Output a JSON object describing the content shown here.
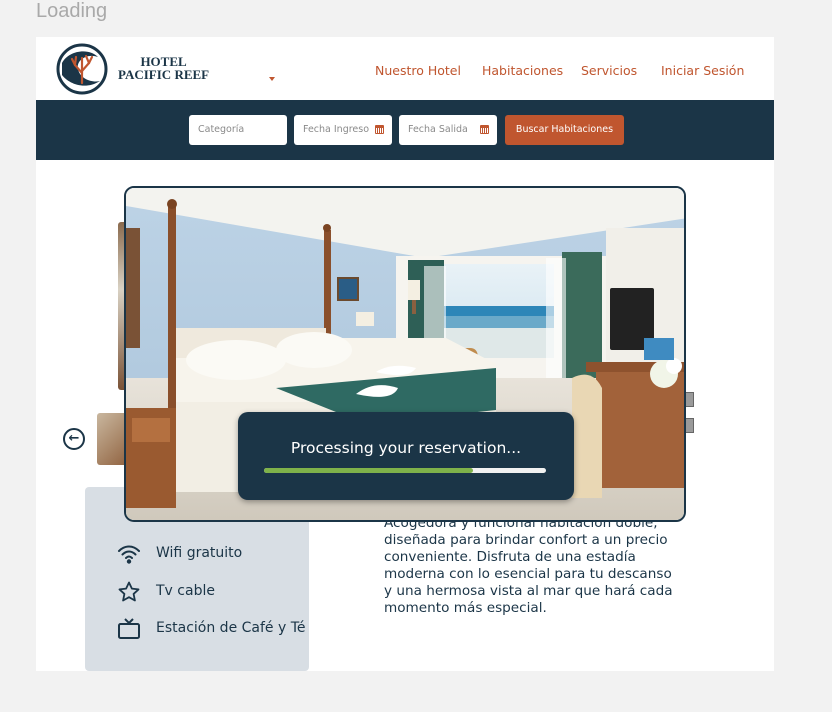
{
  "loading": "Loading",
  "header": {
    "brand_line1": "HOTEL",
    "brand_line2": "PACIFIC REEF",
    "nav": [
      "Nuestro Hotel",
      "Habitaciones",
      "Servicios",
      "Iniciar Sesión"
    ]
  },
  "search": {
    "categoria_placeholder": "Categoría",
    "fecha_ingreso_placeholder": "Fecha Ingreso",
    "fecha_salida_placeholder": "Fecha Salida",
    "button_label": "Buscar Habitaciones"
  },
  "amenities": [
    {
      "icon": "wifi-icon",
      "label": "Wifi gratuito"
    },
    {
      "icon": "star-icon",
      "label": "Tv cable"
    },
    {
      "icon": "tv-icon",
      "label": "Estación de Café y Té"
    }
  ],
  "description": "Acogedora y funcional habitación doble, diseñada para brindar confort a un precio conveniente. Disfruta de una estadía moderna con lo esencial para tu descanso y una hermosa vista al mar que hará cada momento más especial.",
  "modal": {
    "processing_text": "Processing your reservation...",
    "progress": 0.74
  },
  "colors": {
    "navy": "#1b3547",
    "accent": "#c0562f",
    "progress": "#7fb24a"
  }
}
